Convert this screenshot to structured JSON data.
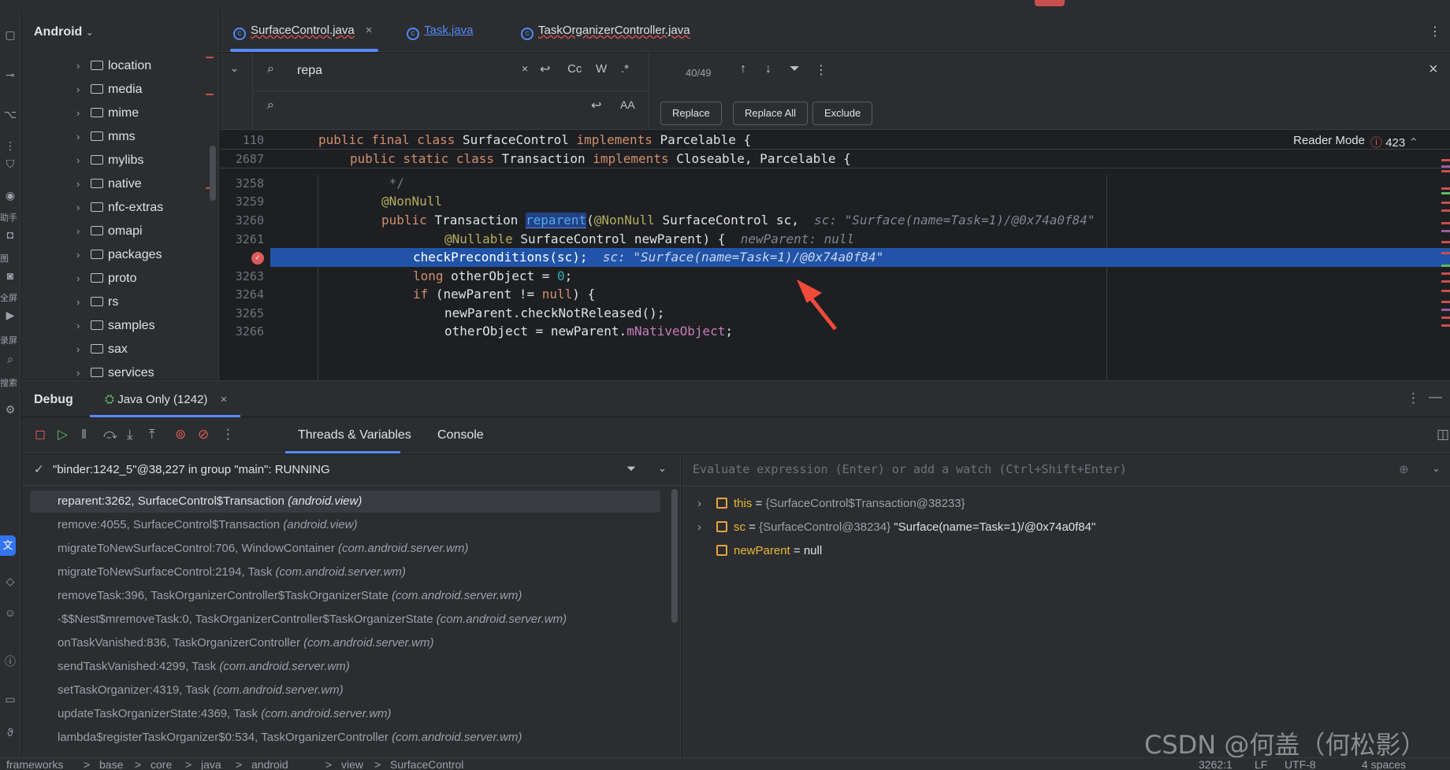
{
  "project": {
    "title": "Android",
    "items": [
      "location",
      "media",
      "mime",
      "mms",
      "mylibs",
      "native",
      "nfc-extras",
      "omapi",
      "packages",
      "proto",
      "rs",
      "samples",
      "sax",
      "services"
    ]
  },
  "activity_labels": [
    "助手",
    "图",
    "全屏",
    "录屏",
    "搜索"
  ],
  "tabs": [
    {
      "label": "SurfaceControl.java",
      "close": "×"
    },
    {
      "label": "Task.java"
    },
    {
      "label": "TaskOrganizerController.java"
    }
  ],
  "find": {
    "query": "repa",
    "match_count": "40/49",
    "opt_case": "Cc",
    "opt_word": "W",
    "opt_regex": ".*",
    "replace_btn": "Replace",
    "replace_all_btn": "Replace All",
    "exclude_btn": "Exclude"
  },
  "editor": {
    "reader_mode": "Reader Mode",
    "error_count": "423",
    "lines": [
      {
        "n": "110",
        "segs": [
          [
            "kw",
            "public final class "
          ],
          [
            "p",
            "SurfaceControl "
          ],
          [
            "kw",
            "implements "
          ],
          [
            "p",
            "Parcelable {"
          ]
        ],
        "indent": 0
      },
      {
        "n": "2687",
        "segs": [
          [
            "kw",
            "public static class "
          ],
          [
            "p",
            "Transaction "
          ],
          [
            "kw",
            "implements "
          ],
          [
            "p",
            "Closeable, Parcelable {"
          ]
        ],
        "indent": 4
      },
      {
        "n": "3258",
        "segs": [
          [
            "cmt",
            " */"
          ]
        ],
        "indent": 8
      },
      {
        "n": "3259",
        "segs": [
          [
            "ann",
            "@NonNull"
          ]
        ],
        "indent": 8
      },
      {
        "n": "3260",
        "segs": [
          [
            "kw",
            "public "
          ],
          [
            "p",
            "Transaction "
          ],
          [
            "hl",
            "reparent"
          ],
          [
            "p",
            "("
          ],
          [
            "ann",
            "@NonNull "
          ],
          [
            "p",
            "SurfaceControl sc,  "
          ],
          [
            "inl",
            "sc: \"Surface(name=Task=1)/@0x74a0f84\""
          ]
        ],
        "indent": 8
      },
      {
        "n": "3261",
        "segs": [
          [
            "ann",
            "@Nullable "
          ],
          [
            "p",
            "SurfaceControl newParent) {  "
          ],
          [
            "inl",
            "newParent: null"
          ]
        ],
        "indent": 16
      },
      {
        "n": "",
        "segs": [
          [
            "p",
            "checkPreconditions(sc);  "
          ],
          [
            "inl",
            "sc: \"Surface(name=Task=1)/@0x74a0f84\""
          ]
        ],
        "indent": 12
      },
      {
        "n": "3263",
        "segs": [
          [
            "kw",
            "long "
          ],
          [
            "p",
            "otherObject = "
          ],
          [
            "num",
            "0"
          ],
          [
            "p",
            ";"
          ]
        ],
        "indent": 12
      },
      {
        "n": "3264",
        "segs": [
          [
            "kw",
            "if "
          ],
          [
            "p",
            "(newParent != "
          ],
          [
            "kw",
            "null"
          ],
          [
            "p",
            ") {"
          ]
        ],
        "indent": 12
      },
      {
        "n": "3265",
        "segs": [
          [
            "p",
            "newParent.checkNotReleased();"
          ]
        ],
        "indent": 16
      },
      {
        "n": "3266",
        "segs": [
          [
            "p",
            "otherObject = newParent."
          ],
          [
            "fld",
            "mNativeObject"
          ],
          [
            "p",
            ";"
          ]
        ],
        "indent": 16
      }
    ]
  },
  "debug": {
    "title": "Debug",
    "session_tab": "Java Only (1242)",
    "subtab_threads": "Threads & Variables",
    "subtab_console": "Console",
    "thread": "\"binder:1242_5\"@38,227 in group \"main\": RUNNING",
    "frames": [
      {
        "m": "reparent:3262, SurfaceControl$Transaction ",
        "p": "(android.view)"
      },
      {
        "m": "remove:4055, SurfaceControl$Transaction ",
        "p": "(android.view)"
      },
      {
        "m": "migrateToNewSurfaceControl:706, WindowContainer ",
        "p": "(com.android.server.wm)"
      },
      {
        "m": "migrateToNewSurfaceControl:2194, Task ",
        "p": "(com.android.server.wm)"
      },
      {
        "m": "removeTask:396, TaskOrganizerController$TaskOrganizerState ",
        "p": "(com.android.server.wm)"
      },
      {
        "m": "-$$Nest$mremoveTask:0, TaskOrganizerController$TaskOrganizerState ",
        "p": "(com.android.server.wm)"
      },
      {
        "m": "onTaskVanished:836, TaskOrganizerController ",
        "p": "(com.android.server.wm)"
      },
      {
        "m": "sendTaskVanished:4299, Task ",
        "p": "(com.android.server.wm)"
      },
      {
        "m": "setTaskOrganizer:4319, Task ",
        "p": "(com.android.server.wm)"
      },
      {
        "m": "updateTaskOrganizerState:4369, Task ",
        "p": "(com.android.server.wm)"
      },
      {
        "m": "lambda$registerTaskOrganizer$0:534, TaskOrganizerController ",
        "p": "(com.android.server.wm)"
      }
    ],
    "eval_placeholder": "Evaluate expression (Enter) or add a watch (Ctrl+Shift+Enter)",
    "vars": [
      {
        "name": "this",
        "eq": " = ",
        "type": "{SurfaceControl$Transaction@38233}",
        "val": ""
      },
      {
        "name": "sc",
        "eq": " = ",
        "type": "{SurfaceControl@38234} ",
        "val": "\"Surface(name=Task=1)/@0x74a0f84\""
      },
      {
        "name": "newParent",
        "eq": " = ",
        "type": "",
        "val": "null"
      }
    ]
  },
  "status": {
    "path": [
      "frameworks",
      "base",
      "core",
      "java",
      "android",
      "view",
      "SurfaceControl"
    ],
    "sep": ">",
    "pos": "3262:1",
    "lf": "LF",
    "enc": "UTF-8",
    "indent": "4 spaces"
  },
  "watermark": "CSDN @何盖（何松影）",
  "colors": {
    "accent": "#548af7",
    "exec_line": "#2154a8",
    "error": "#db5c5c",
    "arrow": "#f04a3a"
  }
}
